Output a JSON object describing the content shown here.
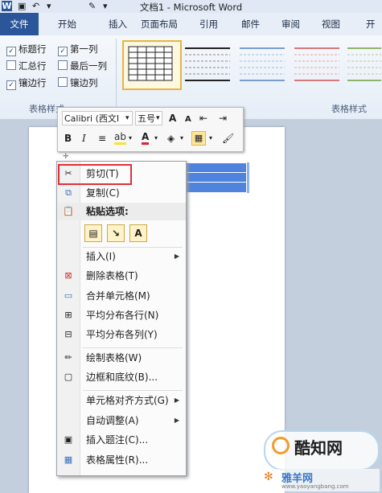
{
  "app": {
    "title": "文档1 - Microsoft Word"
  },
  "tabs": [
    "文件",
    "开始",
    "插入",
    "页面布局",
    "引用",
    "邮件",
    "审阅",
    "视图",
    "开"
  ],
  "ribbon": {
    "options": [
      {
        "label": "标题行",
        "checked": true
      },
      {
        "label": "第一列",
        "checked": true
      },
      {
        "label": "汇总行",
        "checked": false
      },
      {
        "label": "最后一列",
        "checked": false
      },
      {
        "label": "镶边行",
        "checked": true
      },
      {
        "label": "镶边列",
        "checked": false
      }
    ],
    "group_options_label": "表格样式",
    "group_styles_label": "表格样式"
  },
  "mini_toolbar": {
    "font": "Calibri (西文I",
    "size": "五号",
    "grow": "A",
    "shrink": "A",
    "bold": "B",
    "italic": "I",
    "font_color": "A"
  },
  "context_menu": {
    "items": [
      {
        "label": "剪切(T)",
        "icon": "scissors-icon",
        "submenu": false
      },
      {
        "label": "复制(C)",
        "icon": "copy-icon",
        "submenu": false
      },
      {
        "label": "粘贴选项:",
        "icon": "paste-icon",
        "submenu": false
      },
      {
        "label": "插入(I)",
        "icon": "",
        "submenu": true
      },
      {
        "label": "删除表格(T)",
        "icon": "delete-table-icon",
        "submenu": false
      },
      {
        "label": "合并单元格(M)",
        "icon": "merge-cells-icon",
        "submenu": false
      },
      {
        "label": "平均分布各行(N)",
        "icon": "distribute-rows-icon",
        "submenu": false
      },
      {
        "label": "平均分布各列(Y)",
        "icon": "distribute-columns-icon",
        "submenu": false
      },
      {
        "label": "绘制表格(W)",
        "icon": "draw-table-icon",
        "submenu": false
      },
      {
        "label": "边框和底纹(B)...",
        "icon": "borders-icon",
        "submenu": false
      },
      {
        "label": "单元格对齐方式(G)",
        "icon": "",
        "submenu": true
      },
      {
        "label": "自动调整(A)",
        "icon": "",
        "submenu": true
      },
      {
        "label": "插入题注(C)...",
        "icon": "caption-icon",
        "submenu": false
      },
      {
        "label": "表格属性(R)...",
        "icon": "table-properties-icon",
        "submenu": false
      }
    ],
    "paste_buttons": [
      "",
      "",
      "A"
    ]
  },
  "watermark": {
    "brand": "酷知网",
    "site_name": "雅羊网",
    "url": "www.yaoyangbang.com"
  },
  "colors": {
    "file_tab": "#2b579a",
    "highlight_box": "#e0303a",
    "table_selection": "#2f6fd8"
  }
}
